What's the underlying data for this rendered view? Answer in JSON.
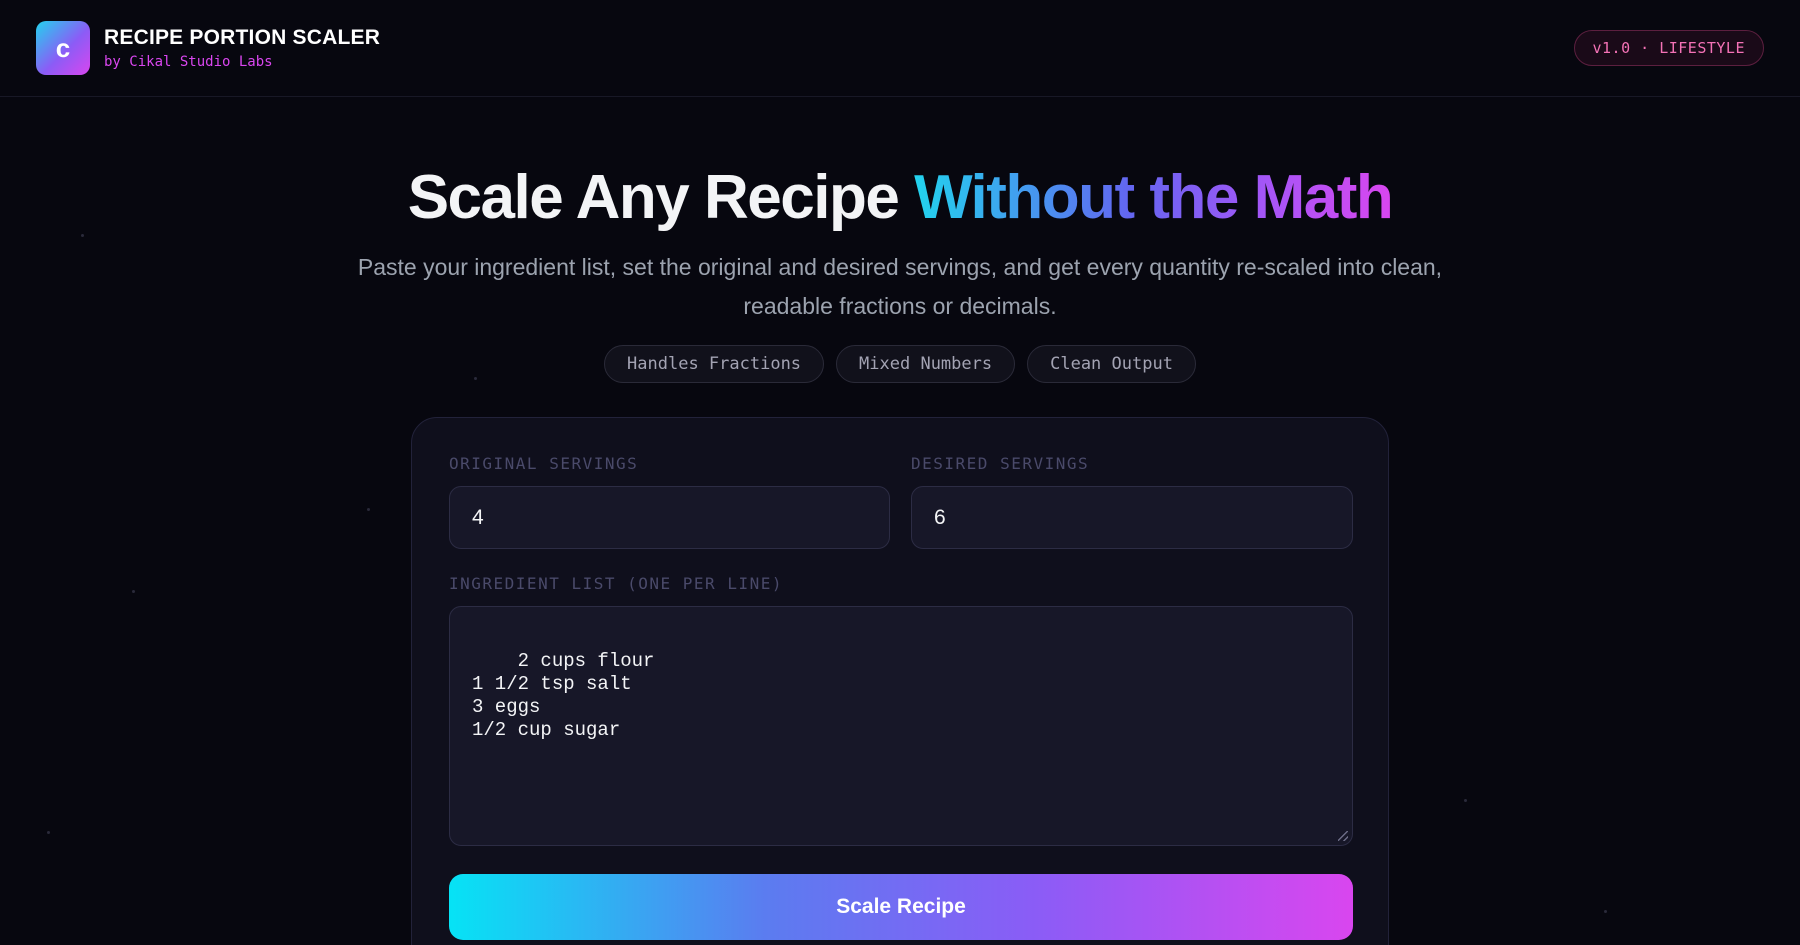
{
  "header": {
    "logo_letter": "c",
    "title": "RECIPE PORTION SCALER",
    "subtitle": "by Cikal Studio Labs",
    "version_badge": "v1.0 · LIFESTYLE"
  },
  "hero": {
    "title_plain": "Scale Any Recipe",
    "title_gradient": "Without the Math",
    "description": "Paste your ingredient list, set the original and desired servings, and get every quantity re-scaled into clean, readable fractions or decimals.",
    "chips": [
      "Handles Fractions",
      "Mixed Numbers",
      "Clean Output"
    ]
  },
  "form": {
    "original_label": "ORIGINAL SERVINGS",
    "original_value": "4",
    "desired_label": "DESIRED SERVINGS",
    "desired_value": "6",
    "ingredients_label": "INGREDIENT LIST (ONE PER LINE)",
    "ingredients_value": "2 cups flour\n1 1/2 tsp salt\n3 eggs\n1/2 cup sugar",
    "submit_label": "Scale Recipe"
  },
  "colors": {
    "background": "#07070f",
    "accent_cyan": "#22d3ee",
    "accent_purple": "#a855f7",
    "accent_magenta": "#d946ef",
    "badge_pink": "#f472b6"
  }
}
